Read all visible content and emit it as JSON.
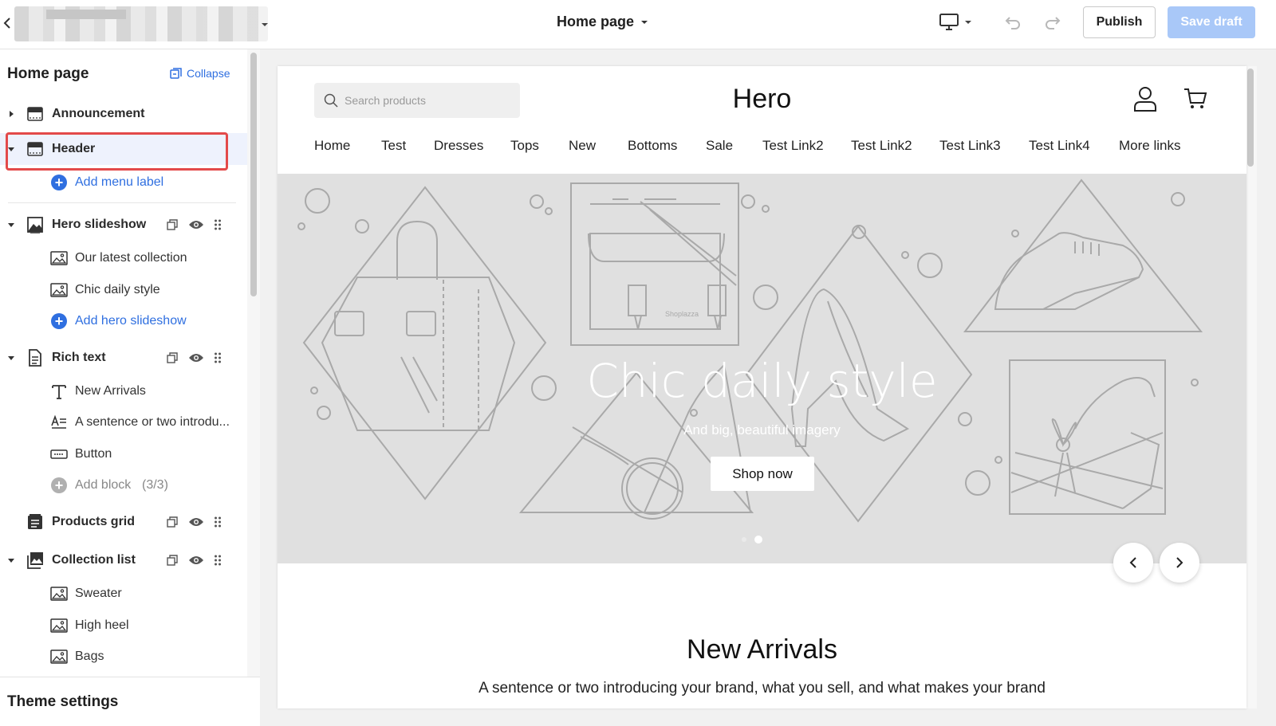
{
  "topbar": {
    "page_selector": "Home page",
    "publish_label": "Publish",
    "save_label": "Save draft"
  },
  "sidebar": {
    "title": "Home page",
    "collapse_label": "Collapse",
    "announcement": "Announcement",
    "header": "Header",
    "add_menu_label": "Add menu label",
    "hero_slideshow": "Hero slideshow",
    "hero_blocks": [
      "Our latest collection",
      "Chic daily style"
    ],
    "add_hero_slideshow": "Add hero slideshow",
    "rich_text": "Rich text",
    "rich_blocks": [
      "New Arrivals",
      "A sentence or two introdu...",
      "Button"
    ],
    "add_block": "Add block",
    "add_block_count": "(3/3)",
    "products_grid": "Products grid",
    "collection_list": "Collection list",
    "collection_blocks": [
      "Sweater",
      "High heel",
      "Bags"
    ],
    "theme_settings": "Theme settings"
  },
  "preview": {
    "search_placeholder": "Search products",
    "store_name": "Hero",
    "nav": [
      "Home",
      "Test",
      "Dresses",
      "Tops",
      "New",
      "Bottoms",
      "Sale",
      "Test Link2",
      "Test Link2",
      "Test Link3",
      "Test Link4",
      "More links"
    ],
    "hero_title": "Chic daily style",
    "hero_subtitle": "And big, beautiful imagery",
    "hero_button": "Shop now",
    "hero_small_text": "Shoplazza",
    "new_arrivals_title": "New Arrivals",
    "new_arrivals_text": "A sentence or two introducing your brand, what you sell, and what makes your brand"
  },
  "colors": {
    "accent": "#2f6fe0",
    "selection_outline": "#e34a4a",
    "save_disabled": "#a9c8f8"
  },
  "icons": [
    "back-icon",
    "caret-down-icon",
    "desktop-icon",
    "undo-icon",
    "redo-icon",
    "collapse-icon",
    "drag-handle-icon",
    "eye-icon",
    "duplicate-icon",
    "search-icon",
    "account-icon",
    "cart-icon",
    "chevron-left-icon",
    "chevron-right-icon"
  ]
}
